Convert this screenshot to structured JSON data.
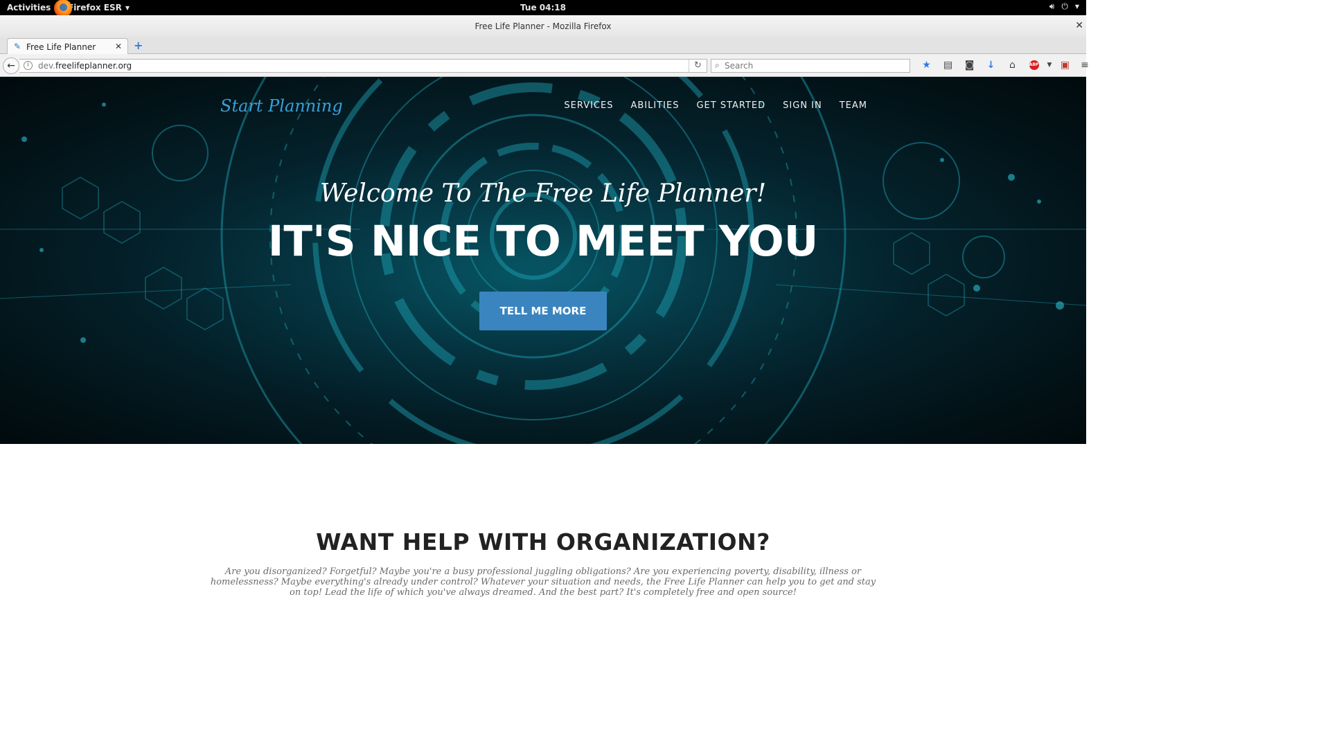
{
  "system_bar": {
    "activities": "Activities",
    "app_name": "Firefox ESR",
    "clock": "Tue 04:18",
    "icons": [
      "volume-icon",
      "power-icon"
    ]
  },
  "window": {
    "title": "Free Life Planner - Mozilla Firefox"
  },
  "tabs": [
    {
      "label": "Free Life Planner",
      "active": true
    }
  ],
  "navbar": {
    "url_subdomain": "dev.",
    "url_domain": "freelifeplanner.org",
    "search_placeholder": "Search",
    "toolbar_icons": [
      "bookmark-star-icon",
      "reading-list-icon",
      "pocket-icon",
      "download-icon",
      "home-icon",
      "adblock-icon",
      "flag-icon",
      "hamburger-menu-icon"
    ]
  },
  "site": {
    "brand": "Start Planning",
    "nav": [
      "SERVICES",
      "ABILITIES",
      "GET STARTED",
      "SIGN IN",
      "TEAM"
    ],
    "welcome": "Welcome To The Free Life Planner!",
    "headline": "IT'S NICE TO MEET YOU",
    "cta": "TELL ME MORE",
    "section_title": "WANT HELP WITH ORGANIZATION?",
    "section_text": "Are you disorganized? Forgetful? Maybe you're a busy professional juggling obligations? Are you experiencing poverty, disability, illness or homelessness? Maybe everything's already under control? Whatever your situation and needs, the Free Life Planner can help you to get and stay on top! Lead the life of which you've always dreamed. And the best part? It's completely free and open source!"
  },
  "colors": {
    "brand": "#3aa0d8",
    "cta": "#3a85bf",
    "hero_bg": "#05222b"
  }
}
